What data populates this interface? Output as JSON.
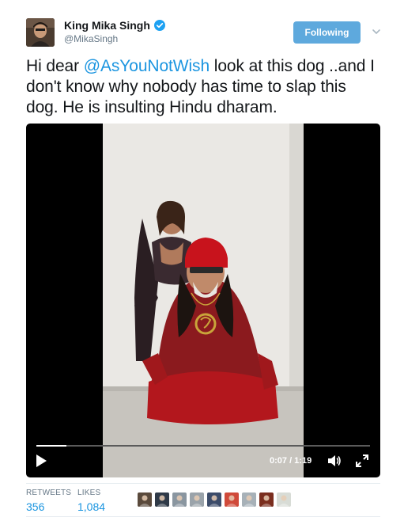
{
  "author": {
    "display_name": "King Mika Singh",
    "handle": "@MikaSingh",
    "verified": true
  },
  "follow_button": {
    "label": "Following"
  },
  "tweet": {
    "text_before": "Hi dear ",
    "mention": "@AsYouNotWish",
    "text_after": " look at this dog ..and I don't know why nobody has time to slap this dog. He is insulting Hindu dharam."
  },
  "video": {
    "time_display": "0:07 / 1:19",
    "progress_fraction": 0.09
  },
  "stats": {
    "retweets_label": "RETWEETS",
    "retweets_value": "356",
    "likes_label": "LIKES",
    "likes_value": "1,084"
  },
  "likers": [
    {
      "name": "liker-avatar-1",
      "color": "#5a4a3c"
    },
    {
      "name": "liker-avatar-2",
      "color": "#2f3a48"
    },
    {
      "name": "liker-avatar-3",
      "color": "#8a96a0"
    },
    {
      "name": "liker-avatar-4",
      "color": "#9aa3aa"
    },
    {
      "name": "liker-avatar-5",
      "color": "#3c4c6a"
    },
    {
      "name": "liker-avatar-6",
      "color": "#d04a3a"
    },
    {
      "name": "liker-avatar-7",
      "color": "#a7b1b8"
    },
    {
      "name": "liker-avatar-8",
      "color": "#7a2e1e"
    },
    {
      "name": "liker-avatar-9",
      "color": "#d8dcd6"
    }
  ],
  "colors": {
    "link": "#1b95e0",
    "follow_button_bg": "#5ea9dd",
    "muted_text": "#657786",
    "verified_badge": "#1da1f2"
  }
}
